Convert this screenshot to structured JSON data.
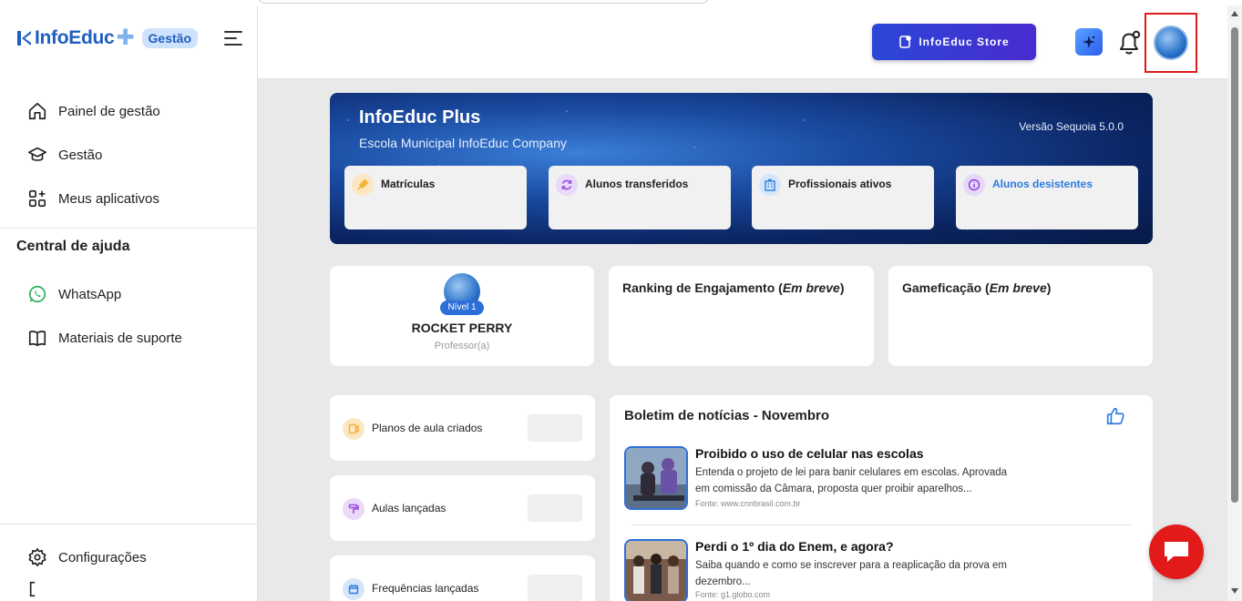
{
  "brand": {
    "name": "InfoEduc",
    "badge": "Gestão"
  },
  "sidebar": {
    "nav": [
      {
        "label": "Painel de gestão",
        "icon": "home-icon"
      },
      {
        "label": "Gestão",
        "icon": "graduation-cap-icon"
      },
      {
        "label": "Meus aplicativos",
        "icon": "apps-grid-icon"
      }
    ],
    "help_title": "Central de ajuda",
    "help": [
      {
        "label": "WhatsApp",
        "icon": "whatsapp-icon"
      },
      {
        "label": "Materiais de suporte",
        "icon": "book-icon"
      }
    ],
    "bottom": [
      {
        "label": "Configurações",
        "icon": "gear-icon"
      }
    ]
  },
  "header": {
    "store_label": "InfoEduc Store"
  },
  "hero": {
    "title": "InfoEduc Plus",
    "subtitle": "Escola Municipal InfoEduc Company",
    "version": "Versão Sequoia 5.0.0",
    "stats": [
      {
        "label": "Matrículas",
        "color": "#f3b23a",
        "bg": "#fbe7c2"
      },
      {
        "label": "Alunos transferidos",
        "color": "#9b4de0",
        "bg": "#ead9f8"
      },
      {
        "label": "Profissionais ativos",
        "color": "#2c7be0",
        "bg": "#d5e6fa"
      },
      {
        "label": "Alunos desistentes",
        "color": "#8a3ad8",
        "bg": "#e6d8f8",
        "text_color": "#2c7be0"
      }
    ]
  },
  "profile": {
    "level": "Nível 1",
    "name": "ROCKET PERRY",
    "role": "Professor(a)"
  },
  "ranking": {
    "title": "Ranking de Engajamento (",
    "italic": "Em breve",
    "close": ")"
  },
  "gamification": {
    "title": "Gameficação (",
    "italic": "Em breve",
    "close": ")"
  },
  "minis": [
    {
      "label": "Planos de aula criados",
      "color": "#f3b23a",
      "bg": "#fbe7c2"
    },
    {
      "label": "Aulas lançadas",
      "color": "#9b4de0",
      "bg": "#ead9f8"
    },
    {
      "label": "Frequências lançadas",
      "color": "#2c7be0",
      "bg": "#d5e6fa"
    }
  ],
  "news": {
    "title": "Boletim de notícias - Novembro",
    "items": [
      {
        "title": "Proibido o uso de celular nas escolas",
        "desc": "Entenda o projeto de lei para banir celulares em escolas. Aprovada em comissão da Câmara, proposta quer proibir aparelhos...",
        "source": "Fonte: www.cnnbrasil.com.br"
      },
      {
        "title": "Perdi o 1º dia do Enem, e agora?",
        "desc": "Saiba quando e como se inscrever para a reaplicação da prova em dezembro...",
        "source": "Fonte: g1.globo.com"
      }
    ]
  }
}
